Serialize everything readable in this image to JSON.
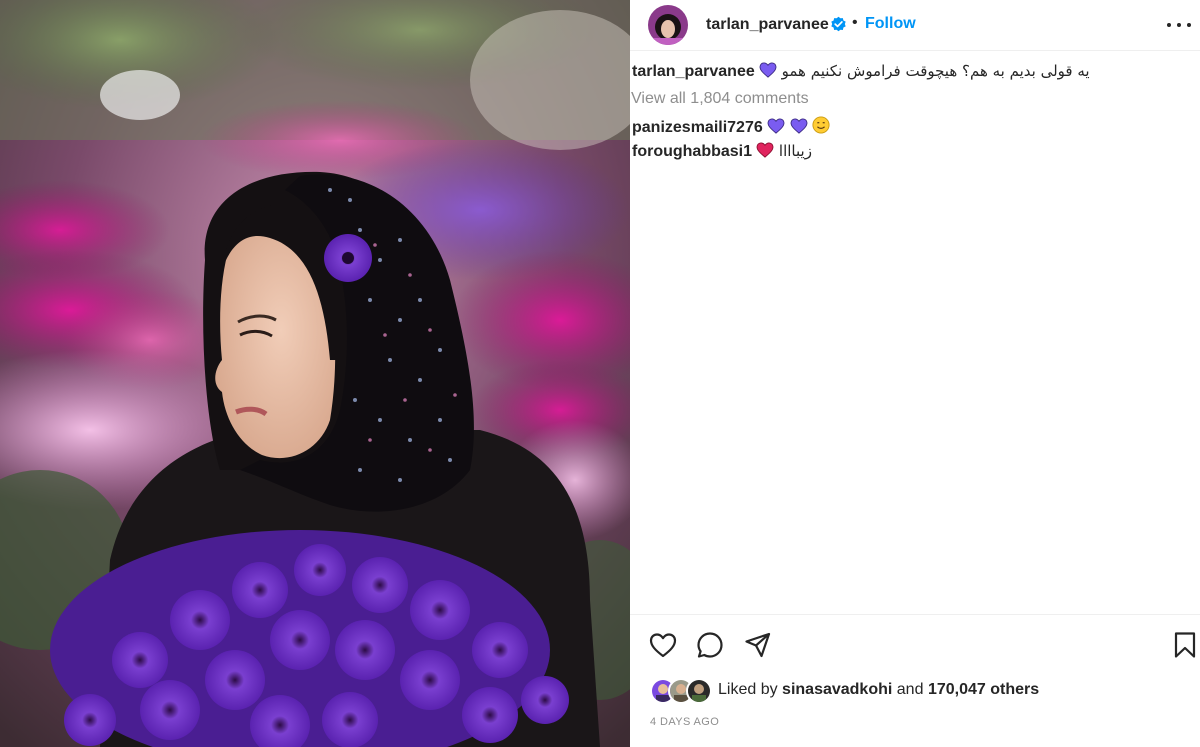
{
  "post": {
    "image_alt": "Woman in black dotted headscarf holding purple flowers among flower displays",
    "header": {
      "username": "tarlan_parvanee",
      "separator": "•",
      "follow_label": "Follow"
    },
    "caption": {
      "username": "tarlan_parvanee",
      "text": "یه قولی بدیم به هم؟ هیچوقت فراموش نکنیم همو"
    },
    "view_all_comments": "View all 1,804 comments",
    "comments": [
      {
        "username": "panizesmaili7276",
        "text": ""
      },
      {
        "username": "foroughabbasi1",
        "text": "زیباااا"
      }
    ],
    "likes": {
      "prefix": "Liked by",
      "user": "sinasavadkohi",
      "middle": "and",
      "count_text": "170,047 others"
    },
    "timestamp": "4 DAYS AGO"
  },
  "colors": {
    "link_blue": "#0095f6",
    "verified_blue": "#0095f6",
    "text": "#262626",
    "muted": "#8e8e8e",
    "heart_purple": "#7a5cf0",
    "heart_red": "#e0245e"
  },
  "icons": [
    "verified-badge-icon",
    "more-options-icon",
    "heart-icon",
    "comment-icon",
    "share-icon",
    "bookmark-icon",
    "purple-heart-icon",
    "smile-emoji-icon",
    "red-heart-icon"
  ]
}
